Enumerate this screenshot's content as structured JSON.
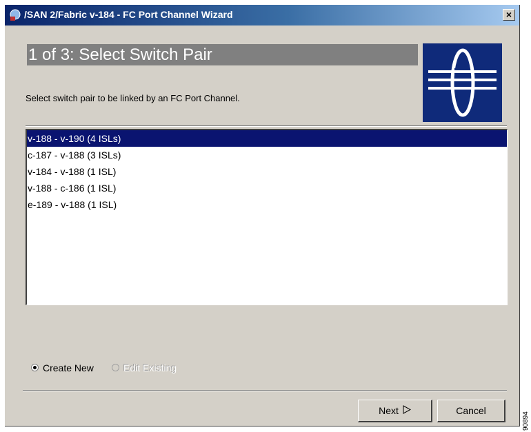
{
  "window": {
    "title": "/SAN 2/Fabric v-184 - FC Port Channel Wizard",
    "close_label": "×"
  },
  "wizard": {
    "step_title": "1 of 3: Select Switch Pair",
    "instructions": "Select switch pair to be linked by an FC Port Channel.",
    "logo_icon": "port-channel-logo-icon"
  },
  "switch_pairs": {
    "items": [
      "v-188 - v-190 (4 ISLs)",
      "c-187 - v-188 (3 ISLs)",
      "v-184 - v-188 (1 ISL)",
      "v-188 - c-186 (1 ISL)",
      "e-189 - v-188 (1 ISL)"
    ],
    "selected_index": 0
  },
  "mode": {
    "create_new_label": "Create New",
    "edit_existing_label": "Edit Existing",
    "selected": "create_new"
  },
  "buttons": {
    "next_label": "Next",
    "cancel_label": "Cancel"
  },
  "figure_id": "90894",
  "colors": {
    "selection": "#0a1470",
    "logo_background": "#0f2a7a",
    "header_background": "#808080"
  }
}
